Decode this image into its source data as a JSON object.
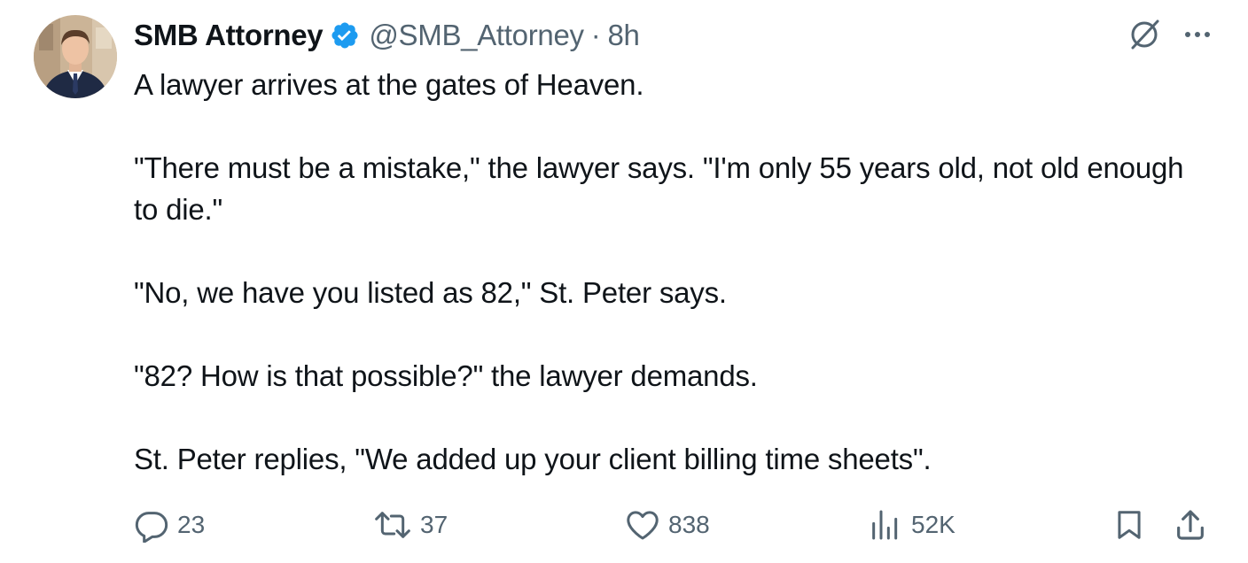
{
  "author": {
    "display_name": "SMB Attorney",
    "handle": "@SMB_Attorney",
    "separator": "·",
    "time": "8h",
    "verified": true,
    "verified_color": "#1d9bf0",
    "avatar_icon": "profile-photo"
  },
  "top_icons": {
    "grok": "slashed-circle-icon",
    "more": "more-icon"
  },
  "tweet": {
    "paragraphs": [
      "A lawyer arrives at the gates of Heaven.",
      "\"There must be a mistake,\" the lawyer says. \"I'm only 55 years old, not old enough to die.\"",
      "\"No, we have you listed as 82,\" St. Peter says.",
      "\"82? How is that possible?\" the lawyer demands.",
      "St. Peter replies, \"We added up your client billing time sheets\"."
    ]
  },
  "actions": {
    "reply": {
      "icon": "reply-icon",
      "count": "23"
    },
    "retweet": {
      "icon": "retweet-icon",
      "count": "37"
    },
    "like": {
      "icon": "heart-icon",
      "count": "838"
    },
    "views": {
      "icon": "views-icon",
      "count": "52K"
    },
    "bookmark": {
      "icon": "bookmark-icon"
    },
    "share": {
      "icon": "share-icon"
    }
  },
  "colors": {
    "text_primary": "#0f1419",
    "text_secondary": "#536471",
    "accent": "#1d9bf0"
  }
}
